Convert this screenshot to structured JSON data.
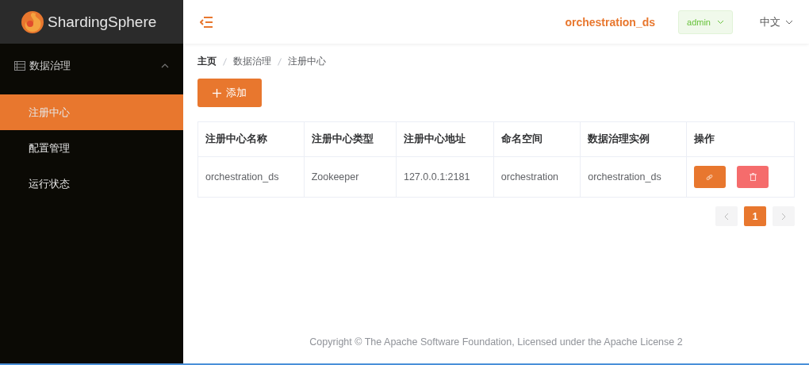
{
  "logo": {
    "text": "ShardingSphere"
  },
  "sidebar": {
    "group": {
      "label": "数据治理",
      "expanded": true
    },
    "items": [
      {
        "label": "注册中心",
        "selected": true
      },
      {
        "label": "配置管理",
        "selected": false
      },
      {
        "label": "运行状态",
        "selected": false
      }
    ]
  },
  "header": {
    "current": "orchestration_ds",
    "user": "admin",
    "language": "中文"
  },
  "breadcrumb": [
    "主页",
    "数据治理",
    "注册中心"
  ],
  "add_button": "添加",
  "table": {
    "columns": [
      "注册中心名称",
      "注册中心类型",
      "注册中心地址",
      "命名空间",
      "数据治理实例",
      "操作"
    ],
    "rows": [
      {
        "cells": [
          "orchestration_ds",
          "Zookeeper",
          "127.0.0.1:2181",
          "orchestration",
          "orchestration_ds"
        ]
      }
    ]
  },
  "pagination": {
    "pages": [
      {
        "label": "1",
        "selected": true
      }
    ]
  },
  "footer": "Copyright © The Apache Software Foundation, Licensed under the Apache License 2"
}
